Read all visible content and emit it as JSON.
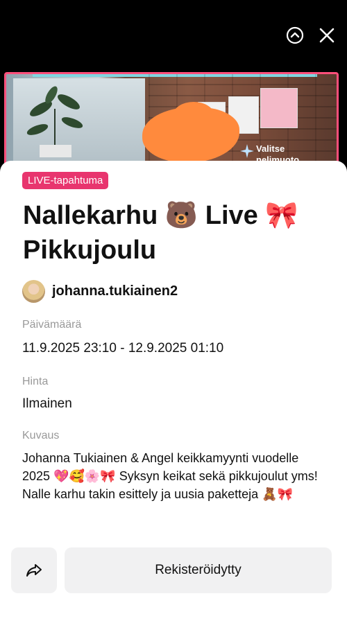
{
  "preview": {
    "choose_text_line1": "Valitse",
    "choose_text_line2": "nelimuoto"
  },
  "event": {
    "badge": "LIVE-tapahtuma",
    "title": "Nallekarhu 🐻 Live 🎀 Pikkujoulu",
    "host_name": "johanna.tukiainen2",
    "date_label": "Päivämäärä",
    "date_value": "11.9.2025 23:10 - 12.9.2025 01:10",
    "price_label": "Hinta",
    "price_value": "Ilmainen",
    "description_label": "Kuvaus",
    "description_text": "Johanna Tukiainen & Angel keikkamyynti vuodelle 2025 💖🥰🌸🎀 Syksyn keikat sekä pikkujoulut yms!  Nalle karhu takin esittely ja uusia paketteja 🧸🎀"
  },
  "actions": {
    "register_label": "Rekisteröidytty"
  },
  "colors": {
    "badge_bg": "#e8356e",
    "preview_border": "#ff4f7b",
    "button_bg": "#f1f1f2"
  },
  "icons": {
    "collapse": "chevron-up-circle-icon",
    "close": "close-icon",
    "share": "share-arrow-icon"
  }
}
